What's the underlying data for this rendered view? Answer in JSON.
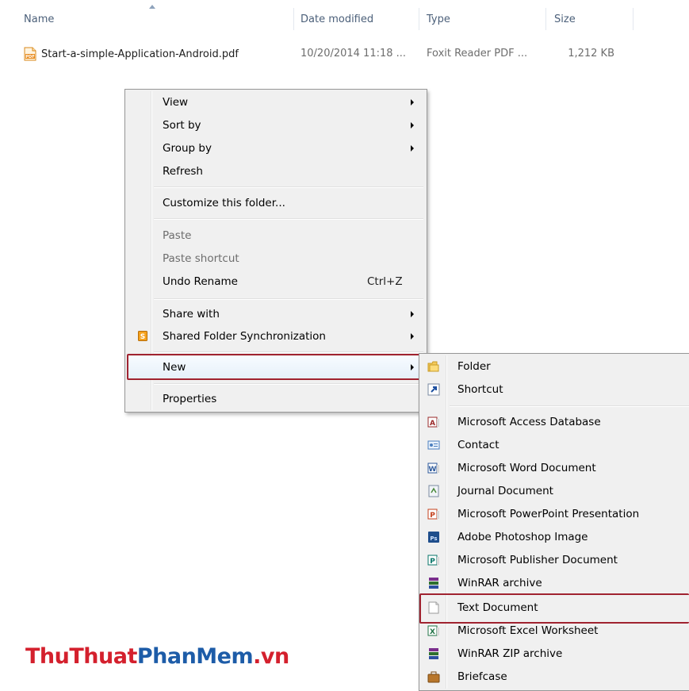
{
  "columns": {
    "name": "Name",
    "date": "Date modified",
    "type": "Type",
    "size": "Size"
  },
  "file": {
    "name": "Start-a-simple-Application-Android.pdf",
    "date": "10/20/2014 11:18 ...",
    "type": "Foxit Reader PDF ...",
    "size": "1,212 KB"
  },
  "context_menu": {
    "view": "View",
    "sort_by": "Sort by",
    "group_by": "Group by",
    "refresh": "Refresh",
    "customize": "Customize this folder...",
    "paste": "Paste",
    "paste_shortcut": "Paste shortcut",
    "undo_rename": "Undo Rename",
    "undo_shortcut": "Ctrl+Z",
    "share_with": "Share with",
    "shared_sync": "Shared Folder Synchronization",
    "new": "New",
    "properties": "Properties"
  },
  "new_submenu": {
    "folder": "Folder",
    "shortcut": "Shortcut",
    "access": "Microsoft Access Database",
    "contact": "Contact",
    "word": "Microsoft Word Document",
    "journal": "Journal Document",
    "powerpoint": "Microsoft PowerPoint Presentation",
    "photoshop": "Adobe Photoshop Image",
    "publisher": "Microsoft Publisher Document",
    "winrar": "WinRAR archive",
    "text": "Text Document",
    "excel": "Microsoft Excel Worksheet",
    "winrar_zip": "WinRAR ZIP archive",
    "briefcase": "Briefcase"
  },
  "watermark": {
    "part1": "ThuThuat",
    "part2": "PhanMem",
    "part3": ".vn"
  },
  "colors": {
    "highlight_border": "#a02330",
    "menu_bg": "#f0f0f0",
    "watermark_red": "#d4202d",
    "watermark_blue": "#1d5ca8"
  }
}
